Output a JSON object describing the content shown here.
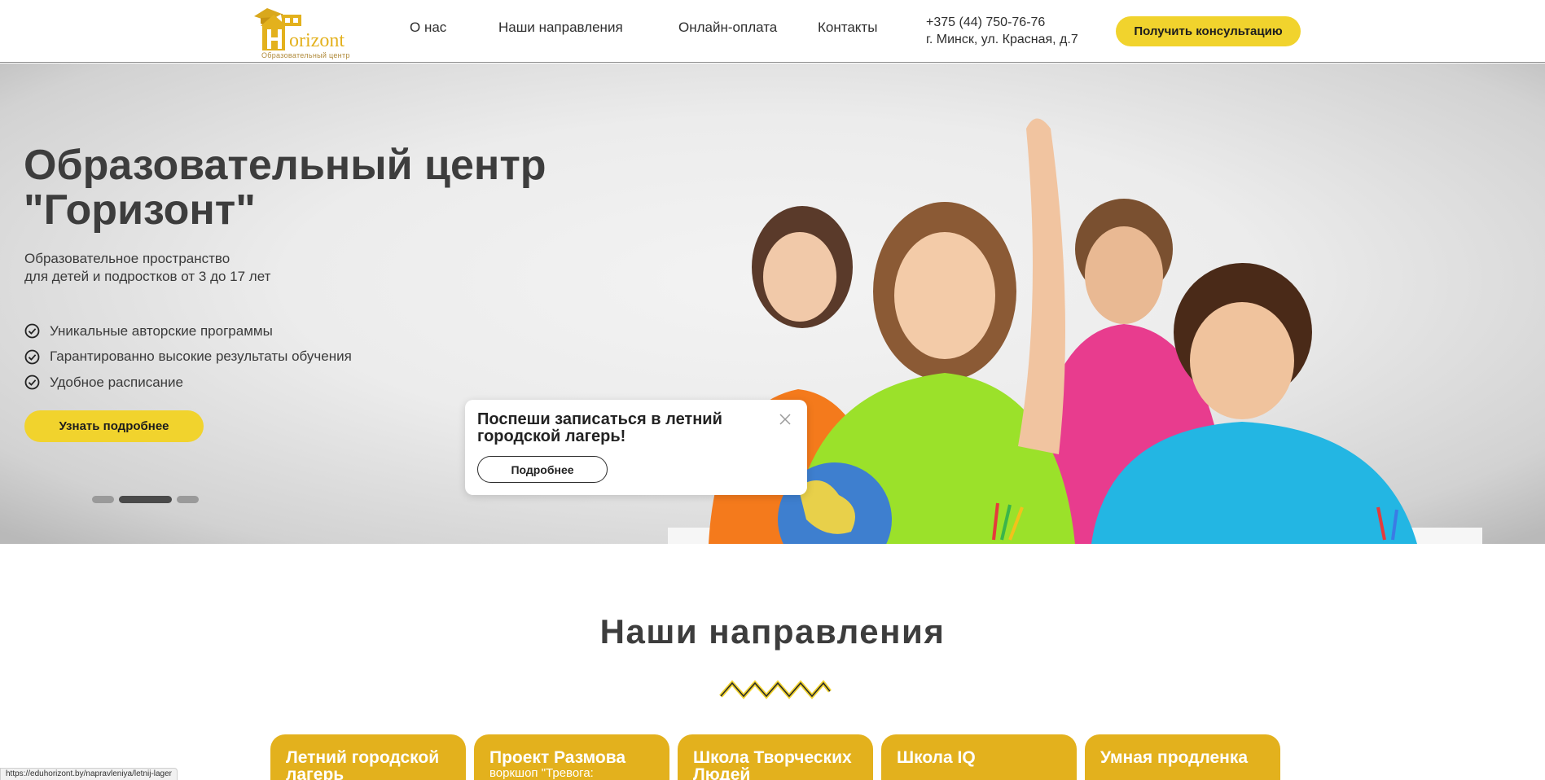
{
  "header": {
    "logo_text": "orizont",
    "logo_letter": "H",
    "logo_tagline": "Образовательный центр",
    "nav": [
      {
        "label": "О нас"
      },
      {
        "label": "Наши направления"
      },
      {
        "label": "Онлайн-оплата"
      },
      {
        "label": "Контакты"
      }
    ],
    "phone": "+375 (44) 750-76-76",
    "address": "г. Минск, ул. Красная, д.7",
    "cta_label": "Получить консультацию"
  },
  "hero": {
    "title": "Образовательный центр \"Горизонт\"",
    "subtitle_line1": "Образовательное пространство",
    "subtitle_line2": "для детей и подростков от 3 до 17 лет",
    "features": [
      "Уникальные авторские программы",
      "Гарантированно высокие результаты обучения",
      "Удобное расписание"
    ],
    "button_label": "Узнать подробнее",
    "slides_count": 3,
    "active_slide": 2
  },
  "popup": {
    "title": "Поспеши записаться в летний городской лагерь!",
    "button_label": "Подробнее"
  },
  "directions": {
    "title": "Наши направления",
    "cards": [
      {
        "title": "Летний городской лагерь",
        "subtitle": ""
      },
      {
        "title": "Проект Размова",
        "subtitle": "воркшоп \"Тревога:"
      },
      {
        "title": "Школа Творческих Людей",
        "subtitle": ""
      },
      {
        "title": "Школа IQ",
        "subtitle": ""
      },
      {
        "title": "Умная продленка",
        "subtitle": ""
      }
    ]
  },
  "status_bar": {
    "url": "https://eduhorizont.by/napravleniya/letnij-lager"
  },
  "colors": {
    "accent_yellow": "#f1d32d",
    "card_gold": "#e3b11d",
    "text_dark": "#3d3d3d"
  }
}
